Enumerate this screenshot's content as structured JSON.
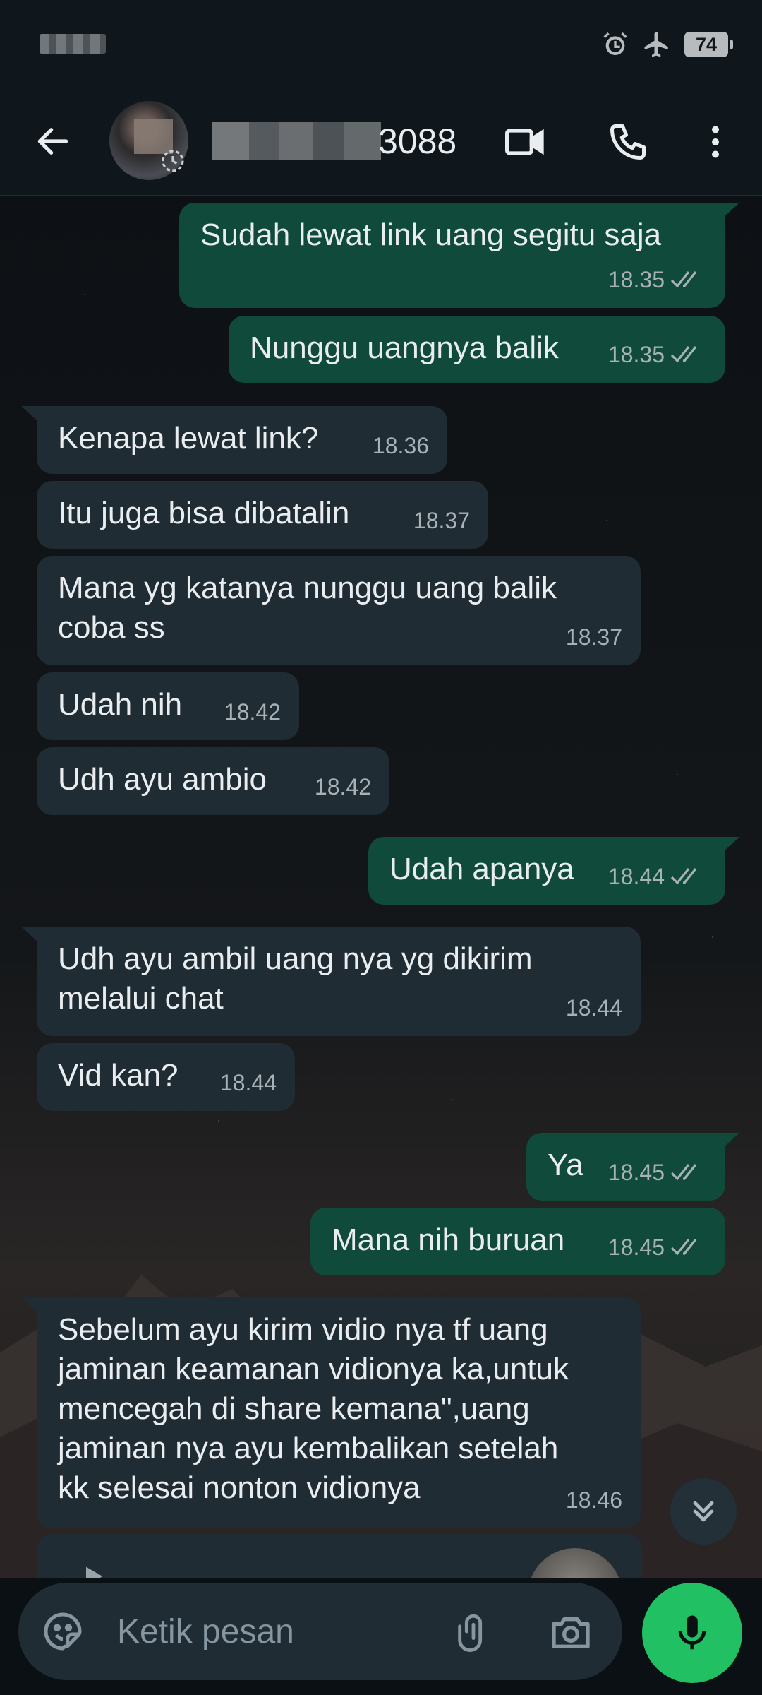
{
  "status_bar": {
    "battery": "74",
    "icons": [
      "alarm-icon",
      "airplane-icon"
    ]
  },
  "header": {
    "contact_suffix": "3088",
    "icons": [
      "back-arrow-icon",
      "video-call-icon",
      "voice-call-icon",
      "more-vert-icon"
    ]
  },
  "colors": {
    "incoming": "#202c33",
    "outgoing": "#0f4a3a",
    "accent": "#21c063"
  },
  "messages": [
    {
      "dir": "out",
      "text": "Sudah lewat link uang segitu saja",
      "time": "18.35",
      "read": true
    },
    {
      "dir": "out",
      "text": "Nunggu uangnya balik",
      "time": "18.35",
      "read": true
    },
    {
      "dir": "in",
      "text": "Kenapa lewat link?",
      "time": "18.36"
    },
    {
      "dir": "in",
      "text": "Itu juga bisa dibatalin",
      "time": "18.37"
    },
    {
      "dir": "in",
      "text": "Mana yg katanya nunggu uang balik\ncoba ss",
      "time": "18.37"
    },
    {
      "dir": "in",
      "text": "Udah nih",
      "time": "18.42"
    },
    {
      "dir": "in",
      "text": "Udh ayu ambio",
      "time": "18.42"
    },
    {
      "dir": "out",
      "text": "Udah apanya",
      "time": "18.44",
      "read": true
    },
    {
      "dir": "in",
      "text": "Udh ayu ambil uang nya yg dikirim\nmelalui chat",
      "time": "18.44"
    },
    {
      "dir": "in",
      "text": "Vid kan?",
      "time": "18.44"
    },
    {
      "dir": "out",
      "text": "Ya",
      "time": "18.45",
      "read": true
    },
    {
      "dir": "out",
      "text": "Mana nih buruan",
      "time": "18.45",
      "read": true
    },
    {
      "dir": "in",
      "text": "Sebelum ayu kirim vidio nya tf uang\njaminan keamanan vidionya ka,untuk\nmencegah di share kemana\",uang\njaminan nya ayu kembalikan setelah\nkk selesai nonton vidionya",
      "time": "18.46"
    }
  ],
  "composer": {
    "placeholder": "Ketik pesan",
    "icons": [
      "emoji-sticker-icon",
      "attach-icon",
      "camera-icon",
      "mic-icon"
    ]
  }
}
